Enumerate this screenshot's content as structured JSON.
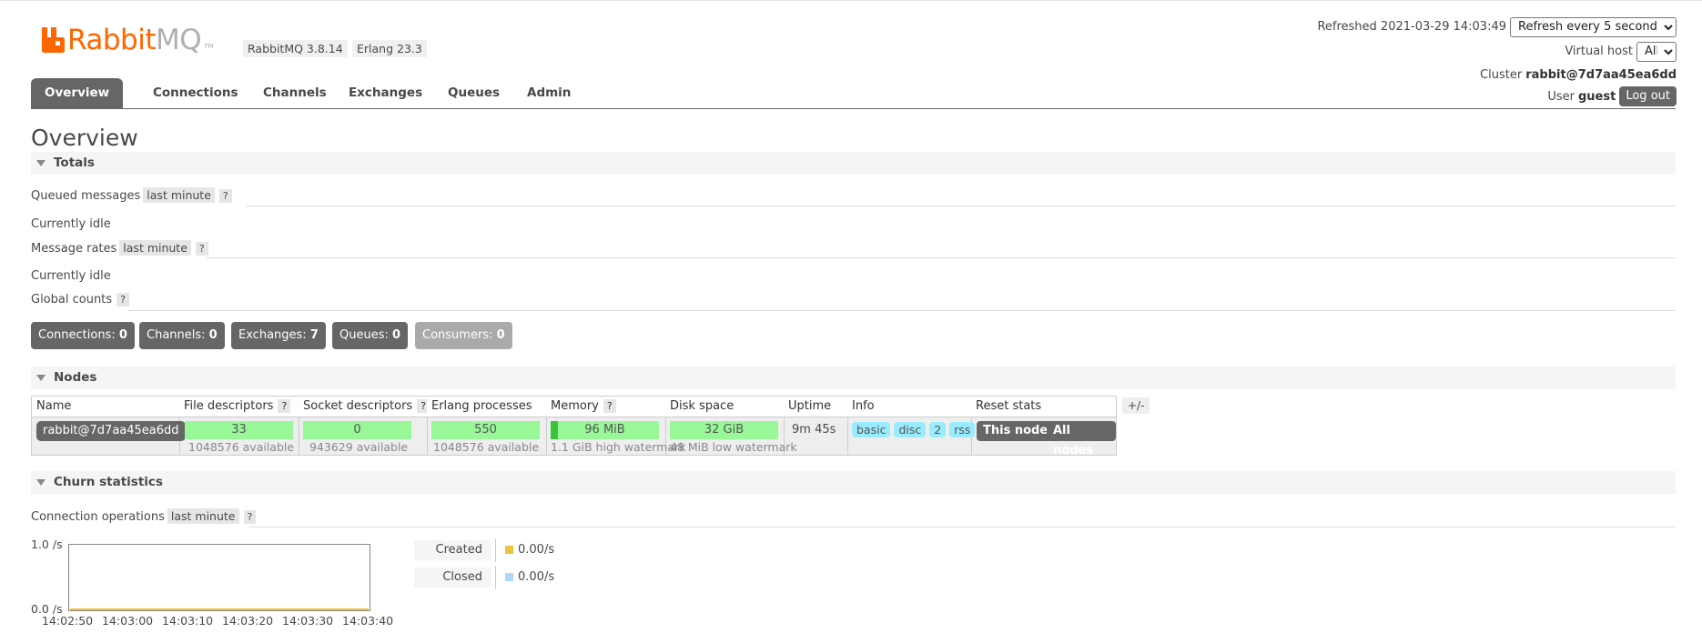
{
  "header": {
    "logo_rabbit": "Rabbit",
    "logo_mq": "MQ",
    "logo_tm": "TM",
    "rabbitmq_version": "RabbitMQ 3.8.14",
    "erlang_version": "Erlang 23.3",
    "refreshed_label": "Refreshed 2021-03-29 14:03:49",
    "refresh_select": "Refresh every 5 seconds",
    "vhost_label": "Virtual host",
    "vhost_select": "All",
    "cluster_label": "Cluster",
    "cluster_name": "rabbit@7d7aa45ea6dd",
    "user_label": "User",
    "user_name": "guest",
    "logout_label": "Log out",
    "logo_color": "#ff6600"
  },
  "tabs": [
    {
      "label": "Overview",
      "active": true
    },
    {
      "label": "Connections"
    },
    {
      "label": "Channels"
    },
    {
      "label": "Exchanges"
    },
    {
      "label": "Queues"
    },
    {
      "label": "Admin"
    }
  ],
  "page_title": "Overview",
  "totals": {
    "heading": "Totals",
    "queued_label": "Queued messages",
    "queued_range": "last minute",
    "help": "?",
    "queued_status": "Currently idle",
    "rates_label": "Message rates",
    "rates_range": "last minute",
    "rates_status": "Currently idle",
    "global_label": "Global counts",
    "counts": [
      {
        "label": "Connections:",
        "value": "0"
      },
      {
        "label": "Channels:",
        "value": "0"
      },
      {
        "label": "Exchanges:",
        "value": "7"
      },
      {
        "label": "Queues:",
        "value": "0"
      },
      {
        "label": "Consumers:",
        "value": "0",
        "disabled": true
      }
    ]
  },
  "nodes": {
    "heading": "Nodes",
    "columns": [
      "Name",
      "File descriptors",
      "Socket descriptors",
      "Erlang processes",
      "Memory",
      "Disk space",
      "Uptime",
      "Info",
      "Reset stats"
    ],
    "toggle_columns": "+/-",
    "row": {
      "name": "rabbit@7d7aa45ea6dd",
      "file_descriptors": "33",
      "file_descriptors_available": "1048576 available",
      "socket_descriptors": "0",
      "socket_descriptors_available": "943629 available",
      "erlang_processes": "550",
      "erlang_processes_available": "1048576 available",
      "memory": "96 MiB",
      "memory_watermark": "1.1 GiB high watermark",
      "disk_space": "32 GiB",
      "disk_watermark": "48 MiB low watermark",
      "uptime": "9m 45s",
      "info": [
        "basic",
        "disc",
        "2",
        "rss"
      ],
      "reset_this": "This node",
      "reset_all": "All nodes"
    },
    "bar_color": "#98f898",
    "info_color": "#99ebff"
  },
  "churn": {
    "heading": "Churn statistics",
    "conn_ops_label": "Connection operations",
    "conn_ops_range": "last minute",
    "help": "?"
  },
  "chart_data": {
    "type": "line",
    "title": "",
    "y_tick_labels": [
      "1.0 /s",
      "0.0 /s"
    ],
    "ylim": [
      0,
      1
    ],
    "x": [
      "14:02:50",
      "14:03:00",
      "14:03:10",
      "14:03:20",
      "14:03:30",
      "14:03:40"
    ],
    "series": [
      {
        "name": "Created",
        "rate": "0.00/s",
        "values": [
          0,
          0,
          0,
          0,
          0,
          0
        ],
        "color": "#edc240"
      },
      {
        "name": "Closed",
        "rate": "0.00/s",
        "values": [
          0,
          0,
          0,
          0,
          0,
          0
        ],
        "color": "#afd8f8"
      }
    ]
  }
}
